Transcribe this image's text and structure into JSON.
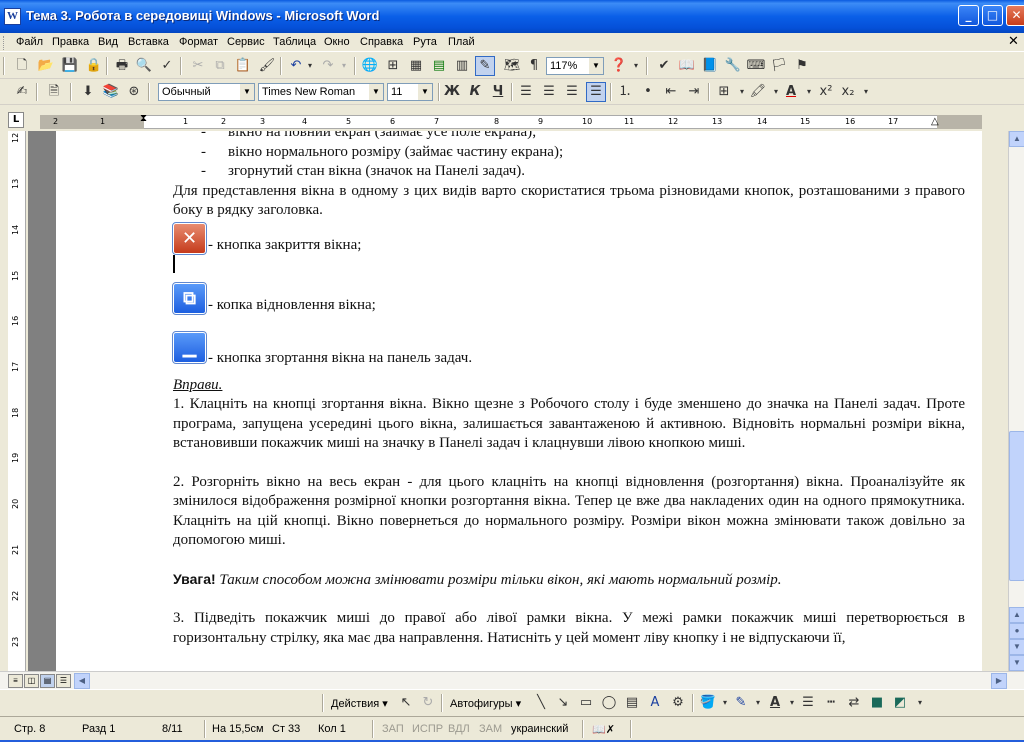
{
  "window": {
    "title": "Тема 3. Робота в середовищі Windows - Microsoft Word",
    "app_icon": "W",
    "controls": {
      "minimize": "_",
      "maximize": "□",
      "close": "✕"
    }
  },
  "menu": {
    "items": [
      "Файл",
      "Правка",
      "Вид",
      "Вставка",
      "Формат",
      "Сервис",
      "Таблица",
      "Окно",
      "Справка",
      "Рута",
      "Плай"
    ],
    "doc_close": "✕"
  },
  "toolbar_standard": {
    "zoom": "117%",
    "icons": [
      "new-doc-icon",
      "open-icon",
      "save-icon",
      "permission-icon",
      "print-icon",
      "print-preview-icon",
      "spelling-icon",
      "cut-icon",
      "copy-icon",
      "paste-icon",
      "format-painter-icon",
      "undo-icon",
      "redo-icon",
      "hyperlink-icon",
      "tables-borders-icon",
      "insert-table-icon",
      "insert-excel-icon",
      "columns-icon",
      "drawing-icon",
      "document-map-icon",
      "show-formatting-icon",
      "help-icon"
    ]
  },
  "toolbar_format": {
    "style": "Обычный",
    "font": "Times New Roman",
    "size": "11",
    "bold": "Ж",
    "italic": "К",
    "underline": "Ч"
  },
  "ruler": {
    "tab_selector": "L",
    "ticks": [
      "2",
      "1",
      "1",
      "2",
      "3",
      "4",
      "5",
      "6",
      "7",
      "8",
      "9",
      "10",
      "11",
      "12",
      "13",
      "14",
      "15",
      "16",
      "17"
    ],
    "vticks": [
      "12",
      "13",
      "14",
      "15",
      "16",
      "17",
      "18",
      "19",
      "20",
      "21",
      "22",
      "23"
    ]
  },
  "document": {
    "bullets": [
      "вікно на повний екран (займає усе поле екрана);",
      "вікно нормального розміру (займає частину екрана);",
      "згорнутий стан вікна (значок на Панелі задач)."
    ],
    "bullet_dash": "-",
    "intro": "Для представлення вікна в одному з цих видів варто скористатися трьома різновидами кнопок, розташованими з правого боку в рядку заголовка.",
    "close_label": "- кнопка закриття вікна;",
    "restore_label": "- копка відновлення вікна;",
    "minimize_label": "- кнопка згортання вікна на панель задач.",
    "exercises_title": "Вправи.",
    "p1": "1. Клацніть на кнопці згортання вікна. Вікно щезне з Робочого столу і буде зменшено до значка на Панелі задач. Проте програма, запущена усередині цього вікна, залишається завантаженою й активною. Відновіть нормальні розміри вікна, встановивши покажчик миші на значку в Панелі задач і клацнувши лівою кнопкою миші.",
    "p2": "2. Розгорніть вікно на весь екран - для цього клацніть на кнопці відновлення (розгортання) вікна. Проаналізуйте як змінилося відображення розмірної кнопки розгортання вікна. Тепер це вже два накладених один на одного прямокутника. Клацніть на цій кнопці. Вікно повернеться до нормального розміру. Розміри вікон можна змінювати також довільно за допомогою миші.",
    "note_label": "Увага!",
    "note_text": "Таким способом можна змінювати розміри тільки вікон, які мають нормальний розмір.",
    "p3": "3. Підведіть покажчик миші до правої або лівої рамки вікна. У межі рамки покажчик миші перетворюється в горизонтальну стрілку, яка має два направлення. Натисніть у цей момент ліву кнопку і не відпускаючи її,"
  },
  "drawing_toolbar": {
    "actions": "Действия ▾",
    "autoshapes": "Автофигуры ▾"
  },
  "status": {
    "page": "Стр. 8",
    "section": "Разд 1",
    "pages": "8/11",
    "position": "На 15,5см",
    "line": "Ст 33",
    "column": "Кол 1",
    "rec": "ЗАП",
    "trk": "ИСПР",
    "ext": "ВДЛ",
    "ovr": "ЗАМ",
    "language": "украинский"
  }
}
